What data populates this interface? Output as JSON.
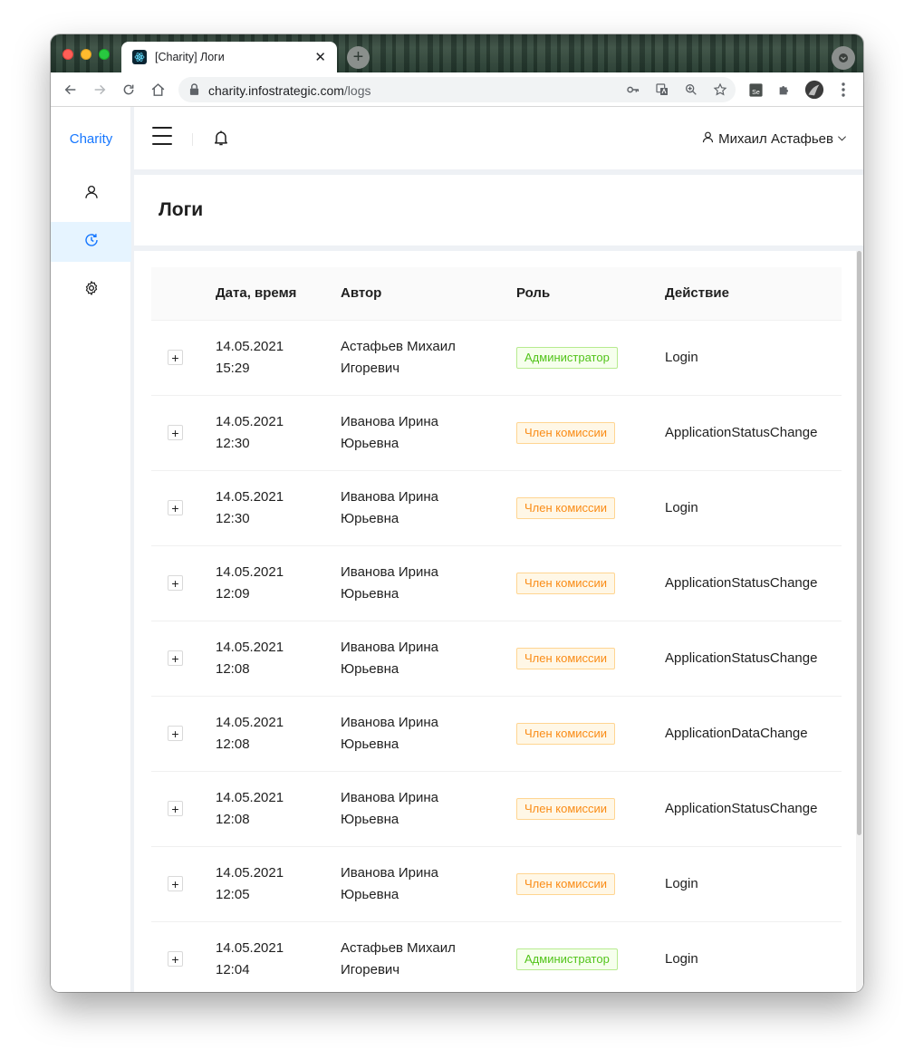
{
  "browser": {
    "tab_title": "[Charity] Логи",
    "tab_close": "✕",
    "new_tab": "+",
    "url_host": "charity.infostrategic.com",
    "url_path": "/logs"
  },
  "sidebar": {
    "brand": "Charity",
    "items": [
      {
        "icon": "user-icon",
        "active": false
      },
      {
        "icon": "history-icon",
        "active": true
      },
      {
        "icon": "settings-icon",
        "active": false
      }
    ]
  },
  "header": {
    "user_name": "Михаил Астафьев"
  },
  "page": {
    "title": "Логи"
  },
  "table": {
    "columns": [
      "Дата, время",
      "Автор",
      "Роль",
      "Действие"
    ],
    "rows": [
      {
        "date": "14.05.2021",
        "time": "15:29",
        "author_1": "Астафьев Михаил",
        "author_2": "Игоревич",
        "role": "Администратор",
        "role_type": "admin",
        "action": "Login"
      },
      {
        "date": "14.05.2021",
        "time": "12:30",
        "author_1": "Иванова Ирина",
        "author_2": "Юрьевна",
        "role": "Член комиссии",
        "role_type": "member",
        "action": "ApplicationStatusChange"
      },
      {
        "date": "14.05.2021",
        "time": "12:30",
        "author_1": "Иванова Ирина",
        "author_2": "Юрьевна",
        "role": "Член комиссии",
        "role_type": "member",
        "action": "Login"
      },
      {
        "date": "14.05.2021",
        "time": "12:09",
        "author_1": "Иванова Ирина",
        "author_2": "Юрьевна",
        "role": "Член комиссии",
        "role_type": "member",
        "action": "ApplicationStatusChange"
      },
      {
        "date": "14.05.2021",
        "time": "12:08",
        "author_1": "Иванова Ирина",
        "author_2": "Юрьевна",
        "role": "Член комиссии",
        "role_type": "member",
        "action": "ApplicationStatusChange"
      },
      {
        "date": "14.05.2021",
        "time": "12:08",
        "author_1": "Иванова Ирина",
        "author_2": "Юрьевна",
        "role": "Член комиссии",
        "role_type": "member",
        "action": "ApplicationDataChange"
      },
      {
        "date": "14.05.2021",
        "time": "12:08",
        "author_1": "Иванова Ирина",
        "author_2": "Юрьевна",
        "role": "Член комиссии",
        "role_type": "member",
        "action": "ApplicationStatusChange"
      },
      {
        "date": "14.05.2021",
        "time": "12:05",
        "author_1": "Иванова Ирина",
        "author_2": "Юрьевна",
        "role": "Член комиссии",
        "role_type": "member",
        "action": "Login"
      },
      {
        "date": "14.05.2021",
        "time": "12:04",
        "author_1": "Астафьев Михаил",
        "author_2": "Игоревич",
        "role": "Администратор",
        "role_type": "admin",
        "action": "Login"
      }
    ]
  },
  "colors": {
    "primary": "#1677ff",
    "admin_tag": "#52c41a",
    "member_tag": "#fa8c16"
  }
}
